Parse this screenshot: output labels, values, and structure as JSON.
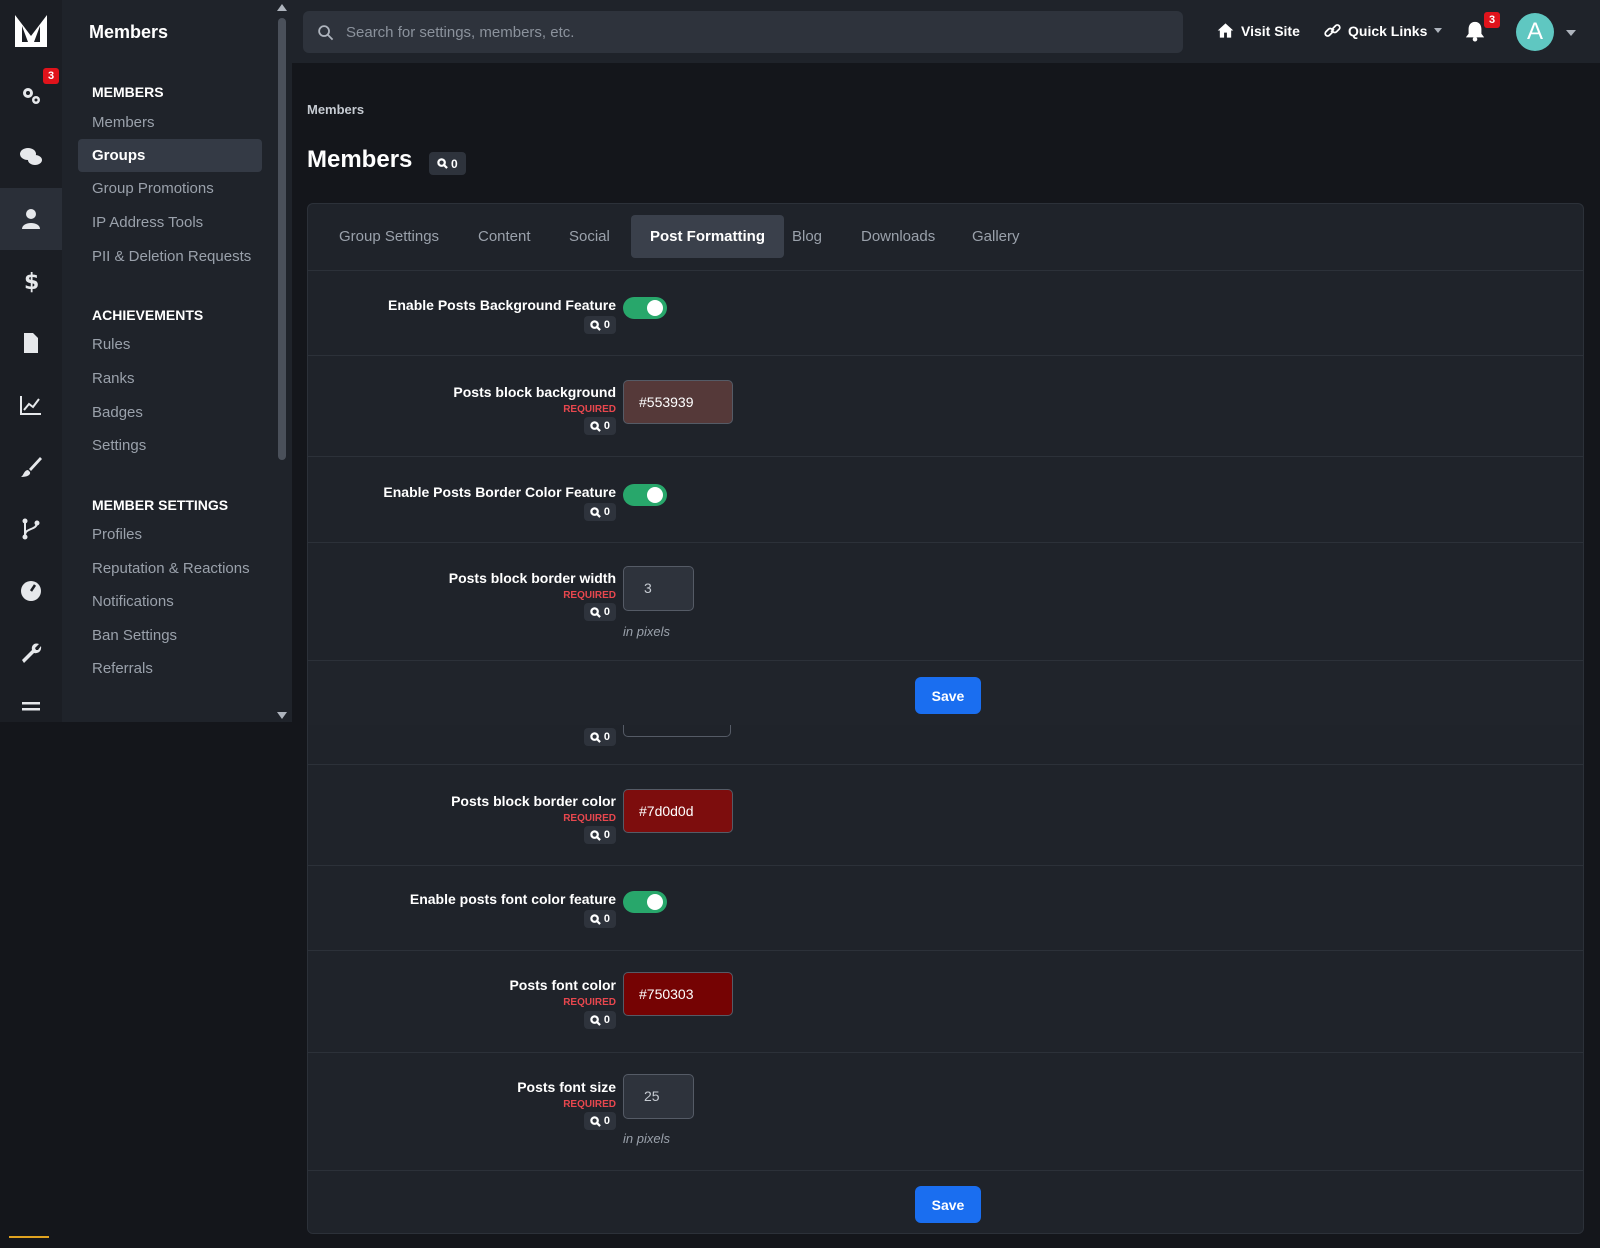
{
  "app": {
    "title": "Members"
  },
  "rail": {
    "settings_badge": "3"
  },
  "sidebar": {
    "sections": [
      {
        "title": "MEMBERS",
        "items": [
          "Members",
          "Groups",
          "Group Promotions",
          "IP Address Tools",
          "PII & Deletion Requests"
        ]
      },
      {
        "title": "ACHIEVEMENTS",
        "items": [
          "Rules",
          "Ranks",
          "Badges",
          "Settings"
        ]
      },
      {
        "title": "MEMBER SETTINGS",
        "items": [
          "Profiles",
          "Reputation & Reactions",
          "Notifications",
          "Ban Settings",
          "Referrals"
        ]
      }
    ],
    "active_item": "Groups"
  },
  "header": {
    "search_placeholder": "Search for settings, members, etc.",
    "visit_site": "Visit Site",
    "quick_links": "Quick Links",
    "notification_badge": "3",
    "avatar_letter": "A"
  },
  "page": {
    "breadcrumb": "Members",
    "title": "Members",
    "title_badge": "0"
  },
  "tabs": [
    "Group Settings",
    "Content",
    "Social",
    "Post Formatting",
    "Blog",
    "Downloads",
    "Gallery"
  ],
  "active_tab": "Post Formatting",
  "required_label": "REQUIRED",
  "hint_pixels": "in pixels",
  "save_label": "Save",
  "badge_count": "0",
  "fields": {
    "bg_feature": {
      "label": "Enable Posts Background Feature",
      "on": true
    },
    "bg_color": {
      "label": "Posts block background",
      "value": "#553939"
    },
    "border_feature": {
      "label": "Enable Posts Border Color Feature",
      "on": true
    },
    "border_width": {
      "label": "Posts block border width",
      "value": "3"
    },
    "border_color": {
      "label": "Posts block border color",
      "value": "#7d0d0d"
    },
    "font_feature": {
      "label": "Enable posts font color feature",
      "on": true
    },
    "font_color": {
      "label": "Posts font color",
      "value": "#750303"
    },
    "font_size": {
      "label": "Posts font size",
      "value": "25"
    }
  },
  "colors": {
    "accent": "#1a6ef0",
    "toggle_on": "#28a76b",
    "required": "#e8474e",
    "badge": "#e0131b"
  }
}
